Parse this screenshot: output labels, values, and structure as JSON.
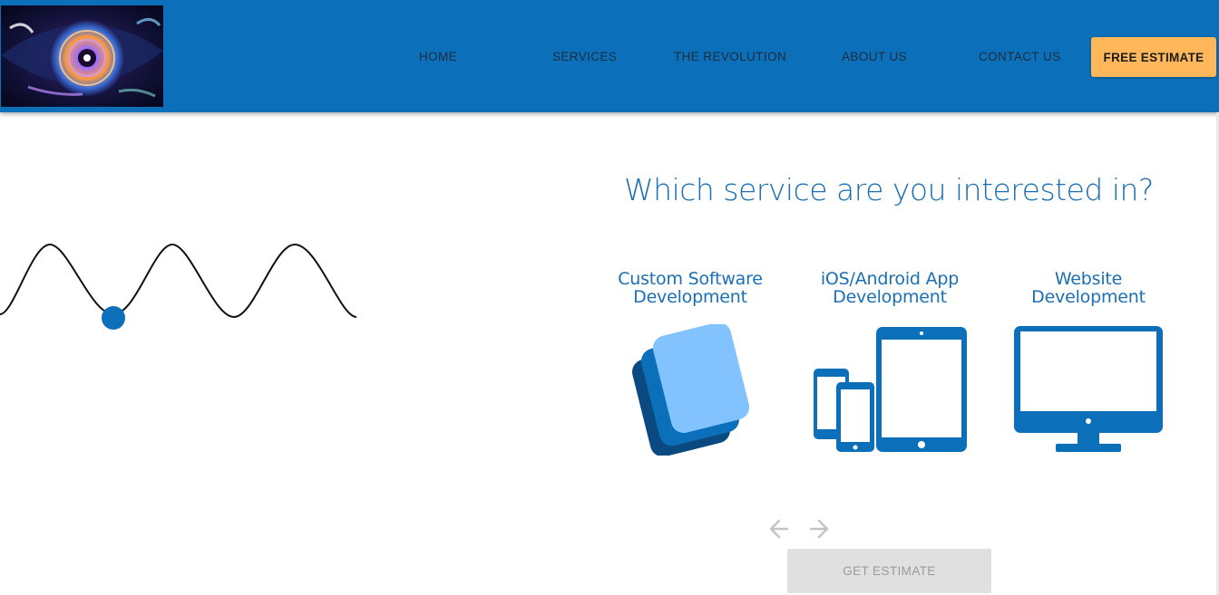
{
  "header": {
    "nav": [
      "HOME",
      "SERVICES",
      "THE REVOLUTION",
      "ABOUT US",
      "CONTACT US"
    ],
    "cta_label": "FREE ESTIMATE",
    "colors": {
      "bar": "#0b70b9",
      "cta": "#ffb75a"
    }
  },
  "main": {
    "question": "Which service are you interested in?",
    "options": [
      {
        "line1": "Custom Software",
        "line2": "Development",
        "icon": "layered-cards-icon"
      },
      {
        "line1": "iOS/Android App",
        "line2": "Development",
        "icon": "devices-icon"
      },
      {
        "line1": "Website",
        "line2": "Development",
        "icon": "desktop-monitor-icon"
      }
    ],
    "prev_icon": "arrow-left-icon",
    "next_icon": "arrow-right-icon",
    "submit_label": "GET ESTIMATE"
  },
  "decor": {
    "wave_icon": "sine-wave-icon",
    "accent": "#1a6fb5"
  }
}
